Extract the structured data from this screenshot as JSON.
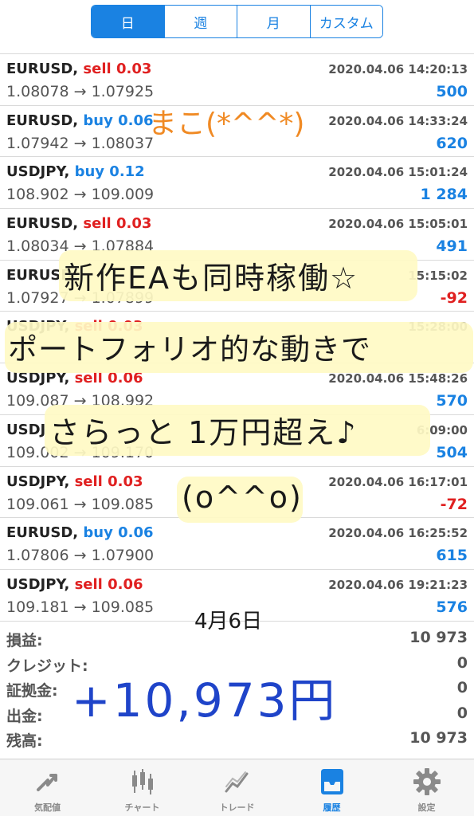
{
  "tabs": [
    {
      "label": "日",
      "active": true
    },
    {
      "label": "週",
      "active": false
    },
    {
      "label": "月",
      "active": false
    },
    {
      "label": "カスタム",
      "active": false
    }
  ],
  "trades": [
    {
      "symbol": "EURUSD",
      "side": "sell",
      "lots": "0.03",
      "open": "1.08078",
      "close": "1.07925",
      "time": "2020.04.06 14:20:13",
      "profit": "500",
      "profit_sign": "pos"
    },
    {
      "symbol": "EURUSD",
      "side": "buy",
      "lots": "0.06",
      "open": "1.07942",
      "close": "1.08037",
      "time": "2020.04.06 14:33:24",
      "profit": "620",
      "profit_sign": "pos"
    },
    {
      "symbol": "USDJPY",
      "side": "buy",
      "lots": "0.12",
      "open": "108.902",
      "close": "109.009",
      "time": "2020.04.06 15:01:24",
      "profit": "1 284",
      "profit_sign": "pos"
    },
    {
      "symbol": "EURUSD",
      "side": "sell",
      "lots": "0.03",
      "open": "1.08034",
      "close": "1.07884",
      "time": "2020.04.06 15:05:01",
      "profit": "491",
      "profit_sign": "pos"
    },
    {
      "symbol": "EURUSD",
      "side": "",
      "lots": "",
      "open": "1.07927",
      "close": "1.07899",
      "time": "15:15:02",
      "profit": "-92",
      "profit_sign": "neg"
    },
    {
      "symbol": "USDJPY",
      "side": "sell",
      "lots": "0.03",
      "open": "",
      "close": "",
      "time": "15:28:00",
      "profit": "",
      "profit_sign": "pos"
    },
    {
      "symbol": "USDJPY",
      "side": "sell",
      "lots": "0.06",
      "open": "109.087",
      "close": "108.992",
      "time": "2020.04.06 15:48:26",
      "profit": "570",
      "profit_sign": "pos"
    },
    {
      "symbol": "USDJ",
      "side": "",
      "lots": "",
      "open": "109.002",
      "close": "109.170",
      "time": "6:09:00",
      "profit": "504",
      "profit_sign": "pos"
    },
    {
      "symbol": "USDJPY",
      "side": "sell",
      "lots": "0.03",
      "open": "109.061",
      "close": "109.085",
      "time": "2020.04.06 16:17:01",
      "profit": "-72",
      "profit_sign": "neg"
    },
    {
      "symbol": "EURUSD",
      "side": "buy",
      "lots": "0.06",
      "open": "1.07806",
      "close": "1.07900",
      "time": "2020.04.06 16:25:52",
      "profit": "615",
      "profit_sign": "pos"
    },
    {
      "symbol": "USDJPY",
      "side": "sell",
      "lots": "0.06",
      "open": "109.181",
      "close": "109.085",
      "time": "2020.04.06 19:21:23",
      "profit": "576",
      "profit_sign": "pos"
    }
  ],
  "summary": [
    {
      "label": "損益:",
      "value": "10 973"
    },
    {
      "label": "クレジット:",
      "value": "0"
    },
    {
      "label": "証拠金:",
      "value": "0"
    },
    {
      "label": "出金:",
      "value": "0"
    },
    {
      "label": "残高:",
      "value": "10 973"
    }
  ],
  "bottom_nav": [
    {
      "label": "気配値",
      "icon": "quotes-icon",
      "active": false
    },
    {
      "label": "チャート",
      "icon": "chart-icon",
      "active": false
    },
    {
      "label": "トレード",
      "icon": "trade-icon",
      "active": false
    },
    {
      "label": "履歴",
      "icon": "history-icon",
      "active": true
    },
    {
      "label": "設定",
      "icon": "settings-icon",
      "active": false
    }
  ],
  "annotations": {
    "name": "まこ(*^^*)",
    "line1": "新作EAも同時稼働☆",
    "line2": "ポートフォリオ的な動きで",
    "line3": "さらっと 1万円超え♪",
    "line4": "(o^^o)",
    "date": "4月6日",
    "total": "+10,973円"
  },
  "colors": {
    "accent": "#1a82e2",
    "sell": "#e02020",
    "buy": "#1a82e2",
    "handwriting_blue": "#1f44c9",
    "handwriting_orange": "#f08a24",
    "highlight": "#fffac4"
  }
}
